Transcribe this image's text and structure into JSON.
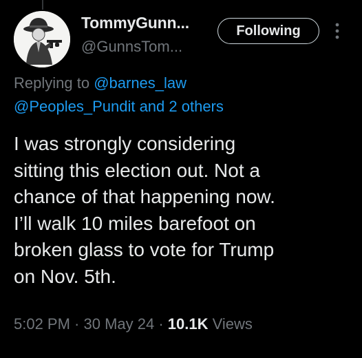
{
  "tweet": {
    "author": {
      "display_name": "TommyGunn...",
      "handle": "@GunnsTom..."
    },
    "follow_button_label": "Following",
    "reply_context": {
      "prefix": "Replying to ",
      "mention_1": "@barnes_law",
      "mention_2": "@Peoples_Pundit",
      "joiner": " and ",
      "others": "2 others"
    },
    "text_lines": [
      "I was strongly considering",
      "sitting this election out. Not a",
      "chance of that happening now.",
      "I’ll walk 10 miles barefoot on",
      "broken glass to vote for Trump",
      "on Nov. 5th."
    ],
    "time": "5:02 PM",
    "separator": " · ",
    "date": "30 May 24",
    "views_count": "10.1K",
    "views_label": " Views"
  },
  "icons": {
    "avatar": "gangster-avatar-icon",
    "more": "more-options-icon"
  },
  "colors": {
    "background": "#000000",
    "text_primary": "#e7e9ea",
    "text_secondary": "#71767b",
    "link": "#1d9bf0",
    "button_border": "#cfd9de"
  }
}
